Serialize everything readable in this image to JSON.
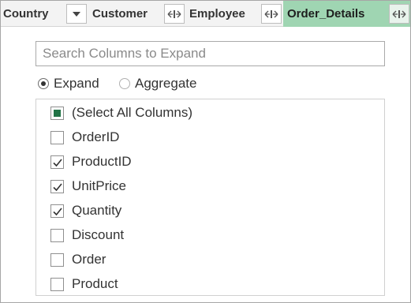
{
  "header": {
    "columns": [
      {
        "label": "Country"
      },
      {
        "label": "Customer"
      },
      {
        "label": "Employee"
      },
      {
        "label": "Order_Details"
      }
    ],
    "active_color": "#9fd5b2"
  },
  "search": {
    "placeholder": "Search Columns to Expand",
    "value": ""
  },
  "mode": {
    "options": [
      {
        "label": "Expand",
        "selected": true
      },
      {
        "label": "Aggregate",
        "selected": false
      }
    ]
  },
  "columns_list": {
    "items": [
      {
        "label": "(Select All Columns)",
        "state": "partial"
      },
      {
        "label": "OrderID",
        "state": "unchecked"
      },
      {
        "label": "ProductID",
        "state": "checked"
      },
      {
        "label": "UnitPrice",
        "state": "checked"
      },
      {
        "label": "Quantity",
        "state": "checked"
      },
      {
        "label": "Discount",
        "state": "unchecked"
      },
      {
        "label": "Order",
        "state": "unchecked"
      },
      {
        "label": "Product",
        "state": "unchecked"
      }
    ]
  },
  "icons": {
    "dropdown": "chevron-down-icon",
    "expand": "expand-column-icon"
  }
}
